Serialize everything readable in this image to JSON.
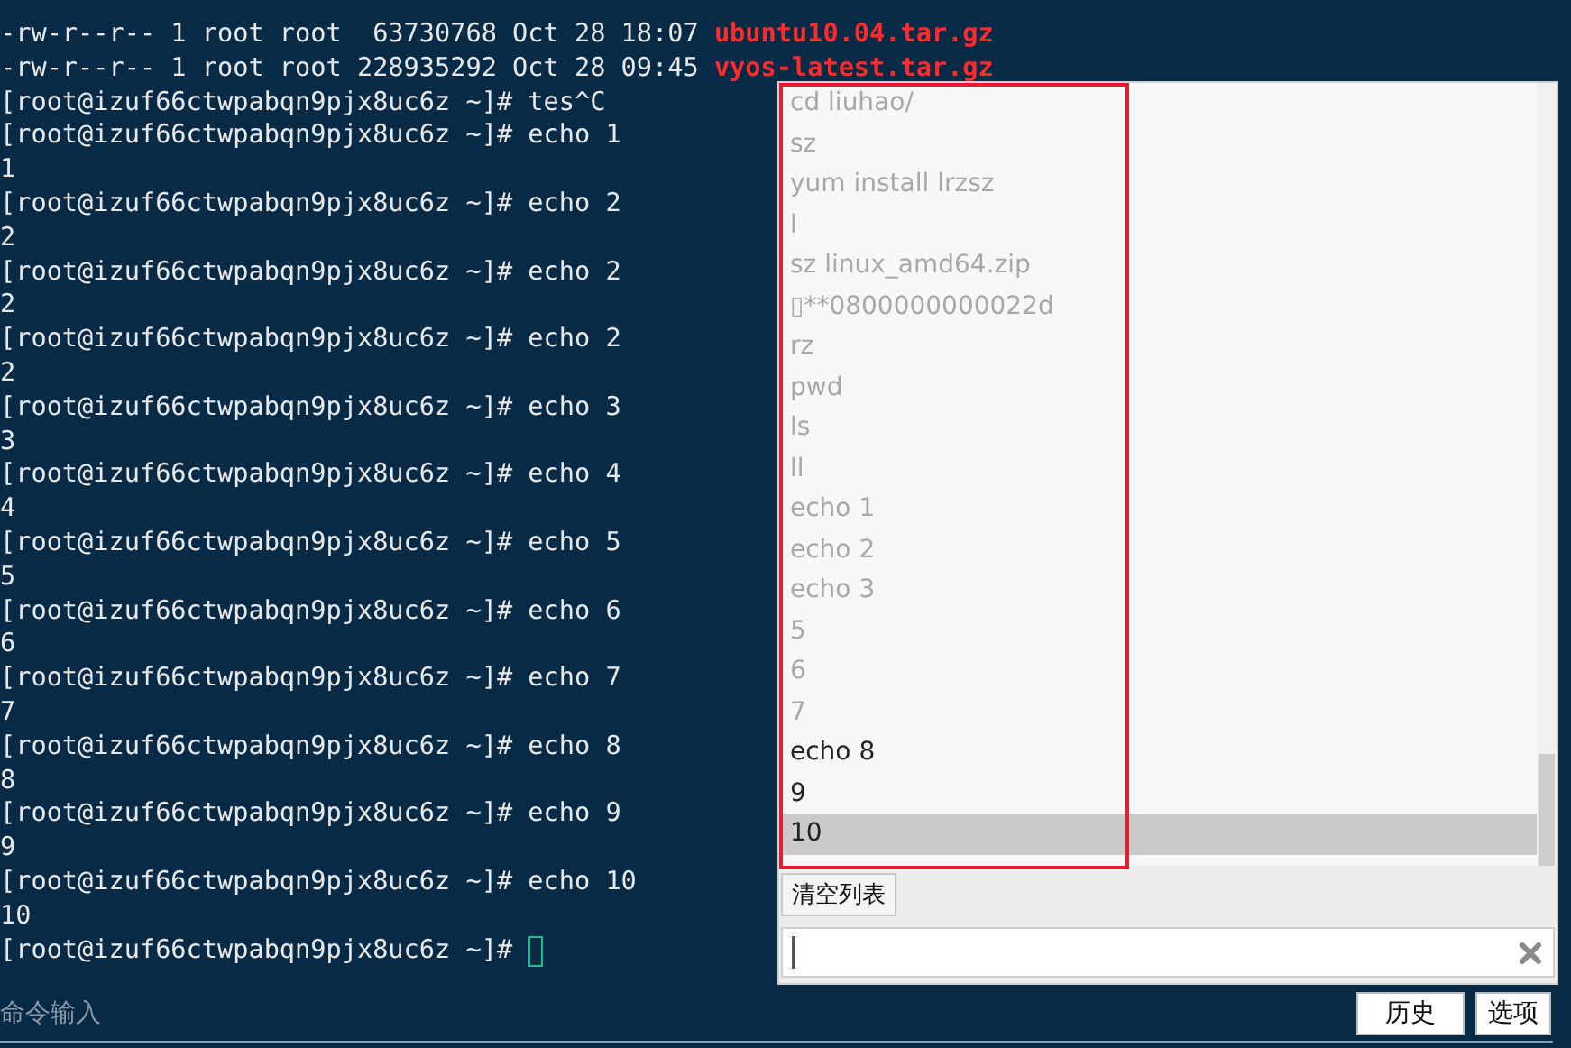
{
  "terminal": {
    "lines": [
      {
        "kind": "file",
        "text": "-rw-r--r-- 1 root root  63730768 Oct 28 18:07",
        "filename": "ubuntu10.04.tar.gz"
      },
      {
        "kind": "file",
        "text": "-rw-r--r-- 1 root root 228935292 Oct 28 09:45",
        "filename": "vyos-latest.tar.gz"
      },
      {
        "kind": "prompt",
        "prompt": "[root@izuf66ctwpabqn9pjx8uc6z ~]#",
        "command": "tes^C"
      },
      {
        "kind": "prompt",
        "prompt": "[root@izuf66ctwpabqn9pjx8uc6z ~]#",
        "command": "echo 1"
      },
      {
        "kind": "output",
        "text": "1"
      },
      {
        "kind": "prompt",
        "prompt": "[root@izuf66ctwpabqn9pjx8uc6z ~]#",
        "command": "echo 2"
      },
      {
        "kind": "output",
        "text": "2"
      },
      {
        "kind": "prompt",
        "prompt": "[root@izuf66ctwpabqn9pjx8uc6z ~]#",
        "command": "echo 2"
      },
      {
        "kind": "output",
        "text": "2"
      },
      {
        "kind": "prompt",
        "prompt": "[root@izuf66ctwpabqn9pjx8uc6z ~]#",
        "command": "echo 2"
      },
      {
        "kind": "output",
        "text": "2"
      },
      {
        "kind": "prompt",
        "prompt": "[root@izuf66ctwpabqn9pjx8uc6z ~]#",
        "command": "echo 3"
      },
      {
        "kind": "output",
        "text": "3"
      },
      {
        "kind": "prompt",
        "prompt": "[root@izuf66ctwpabqn9pjx8uc6z ~]#",
        "command": "echo 4"
      },
      {
        "kind": "output",
        "text": "4"
      },
      {
        "kind": "prompt",
        "prompt": "[root@izuf66ctwpabqn9pjx8uc6z ~]#",
        "command": "echo 5"
      },
      {
        "kind": "output",
        "text": "5"
      },
      {
        "kind": "prompt",
        "prompt": "[root@izuf66ctwpabqn9pjx8uc6z ~]#",
        "command": "echo 6"
      },
      {
        "kind": "output",
        "text": "6"
      },
      {
        "kind": "prompt",
        "prompt": "[root@izuf66ctwpabqn9pjx8uc6z ~]#",
        "command": "echo 7"
      },
      {
        "kind": "output",
        "text": "7"
      },
      {
        "kind": "prompt",
        "prompt": "[root@izuf66ctwpabqn9pjx8uc6z ~]#",
        "command": "echo 8"
      },
      {
        "kind": "output",
        "text": "8"
      },
      {
        "kind": "prompt",
        "prompt": "[root@izuf66ctwpabqn9pjx8uc6z ~]#",
        "command": "echo 9"
      },
      {
        "kind": "output",
        "text": "9"
      },
      {
        "kind": "prompt",
        "prompt": "[root@izuf66ctwpabqn9pjx8uc6z ~]#",
        "command": "echo 10"
      },
      {
        "kind": "output",
        "text": "10"
      },
      {
        "kind": "cursor",
        "prompt": "[root@izuf66ctwpabqn9pjx8uc6z ~]#"
      }
    ]
  },
  "history_panel": {
    "items": [
      {
        "text": "cd liuhao/",
        "dimmed": true,
        "selected": false
      },
      {
        "text": "sz",
        "dimmed": true,
        "selected": false
      },
      {
        "text": "yum install lrzsz",
        "dimmed": true,
        "selected": false
      },
      {
        "text": "l",
        "dimmed": true,
        "selected": false
      },
      {
        "text": "sz linux_amd64.zip",
        "dimmed": true,
        "selected": false
      },
      {
        "text": "▯**0800000000022d",
        "dimmed": true,
        "selected": false
      },
      {
        "text": "rz",
        "dimmed": true,
        "selected": false
      },
      {
        "text": "pwd",
        "dimmed": true,
        "selected": false
      },
      {
        "text": "ls",
        "dimmed": true,
        "selected": false
      },
      {
        "text": "ll",
        "dimmed": true,
        "selected": false
      },
      {
        "text": "echo 1",
        "dimmed": true,
        "selected": false
      },
      {
        "text": "echo 2",
        "dimmed": true,
        "selected": false
      },
      {
        "text": "echo 3",
        "dimmed": true,
        "selected": false
      },
      {
        "text": "5",
        "dimmed": true,
        "selected": false
      },
      {
        "text": "6",
        "dimmed": true,
        "selected": false
      },
      {
        "text": "7",
        "dimmed": true,
        "selected": false
      },
      {
        "text": "echo 8",
        "dimmed": false,
        "selected": false
      },
      {
        "text": "9",
        "dimmed": false,
        "selected": false
      },
      {
        "text": "10",
        "dimmed": false,
        "selected": true
      }
    ],
    "clear_button": "清空列表"
  },
  "command_input": {
    "label": "命令输入"
  },
  "buttons": [
    "历史",
    "选项"
  ]
}
